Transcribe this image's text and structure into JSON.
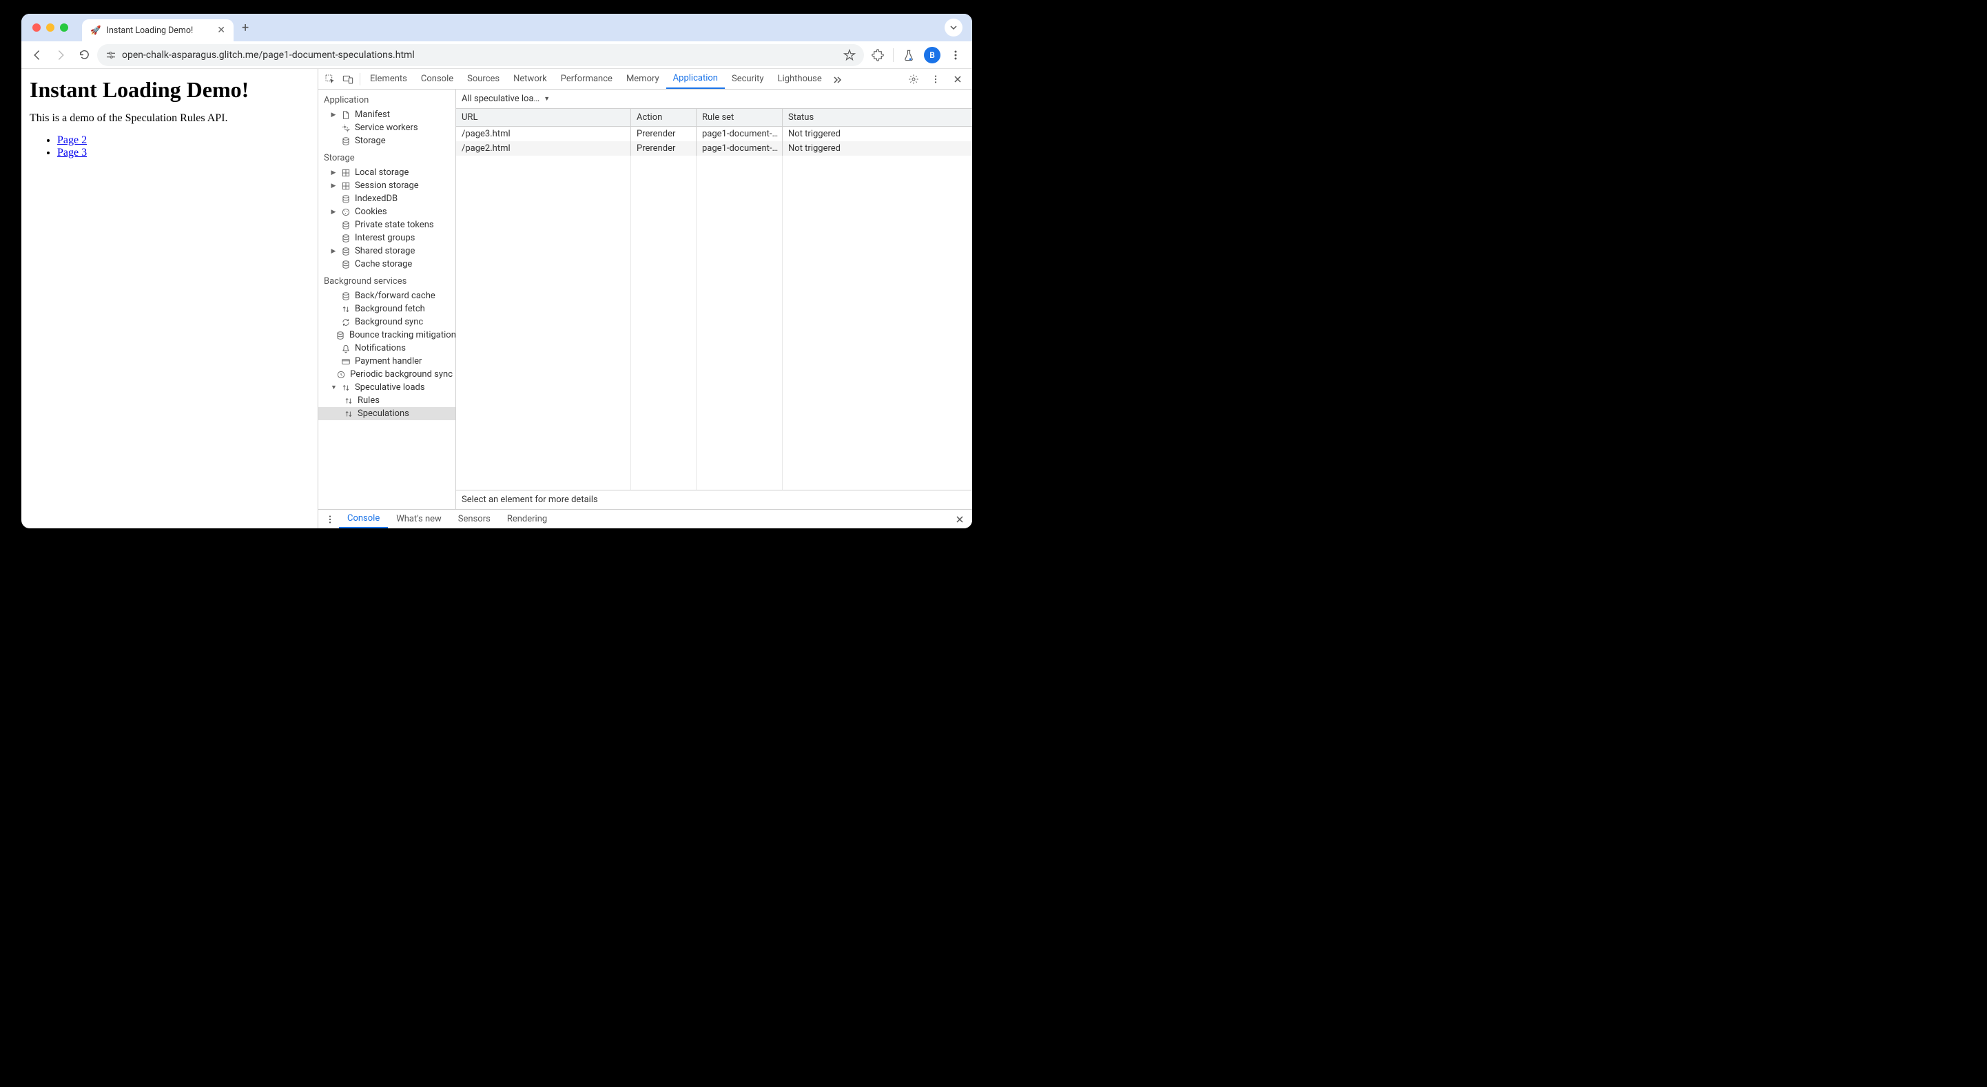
{
  "tab": {
    "favicon": "🚀",
    "title": "Instant Loading Demo!"
  },
  "address": "open-chalk-asparagus.glitch.me/page1-document-speculations.html",
  "avatar_letter": "B",
  "page": {
    "heading": "Instant Loading Demo!",
    "subtext": "This is a demo of the Speculation Rules API.",
    "links": [
      "Page 2",
      "Page 3"
    ]
  },
  "devtools": {
    "tabs": [
      "Elements",
      "Console",
      "Sources",
      "Network",
      "Performance",
      "Memory",
      "Application",
      "Security",
      "Lighthouse"
    ],
    "active_tab": "Application",
    "sidebar": {
      "sections": [
        {
          "title": "Application",
          "items": [
            {
              "label": "Manifest",
              "icon": "file",
              "expandable": true
            },
            {
              "label": "Service workers",
              "icon": "gears"
            },
            {
              "label": "Storage",
              "icon": "db"
            }
          ]
        },
        {
          "title": "Storage",
          "items": [
            {
              "label": "Local storage",
              "icon": "grid",
              "expandable": true
            },
            {
              "label": "Session storage",
              "icon": "grid",
              "expandable": true
            },
            {
              "label": "IndexedDB",
              "icon": "db"
            },
            {
              "label": "Cookies",
              "icon": "cookie",
              "expandable": true
            },
            {
              "label": "Private state tokens",
              "icon": "db"
            },
            {
              "label": "Interest groups",
              "icon": "db"
            },
            {
              "label": "Shared storage",
              "icon": "db",
              "expandable": true
            },
            {
              "label": "Cache storage",
              "icon": "db"
            }
          ]
        },
        {
          "title": "Background services",
          "items": [
            {
              "label": "Back/forward cache",
              "icon": "db"
            },
            {
              "label": "Background fetch",
              "icon": "updown"
            },
            {
              "label": "Background sync",
              "icon": "sync"
            },
            {
              "label": "Bounce tracking mitigation",
              "icon": "db"
            },
            {
              "label": "Notifications",
              "icon": "bell"
            },
            {
              "label": "Payment handler",
              "icon": "card"
            },
            {
              "label": "Periodic background sync",
              "icon": "clock"
            },
            {
              "label": "Speculative loads",
              "icon": "updown",
              "expandable": true,
              "expanded": true,
              "children": [
                {
                  "label": "Rules",
                  "icon": "updown"
                },
                {
                  "label": "Speculations",
                  "icon": "updown",
                  "selected": true
                }
              ]
            }
          ]
        }
      ]
    },
    "main": {
      "dropdown_label": "All speculative loa…",
      "columns": [
        "URL",
        "Action",
        "Rule set",
        "Status"
      ],
      "rows": [
        {
          "url": "/page3.html",
          "action": "Prerender",
          "ruleset": "page1-document-…",
          "status": "Not triggered"
        },
        {
          "url": "/page2.html",
          "action": "Prerender",
          "ruleset": "page1-document-…",
          "status": "Not triggered"
        }
      ],
      "detail_text": "Select an element for more details"
    },
    "drawer": {
      "tabs": [
        "Console",
        "What's new",
        "Sensors",
        "Rendering"
      ],
      "active": "Console"
    }
  }
}
